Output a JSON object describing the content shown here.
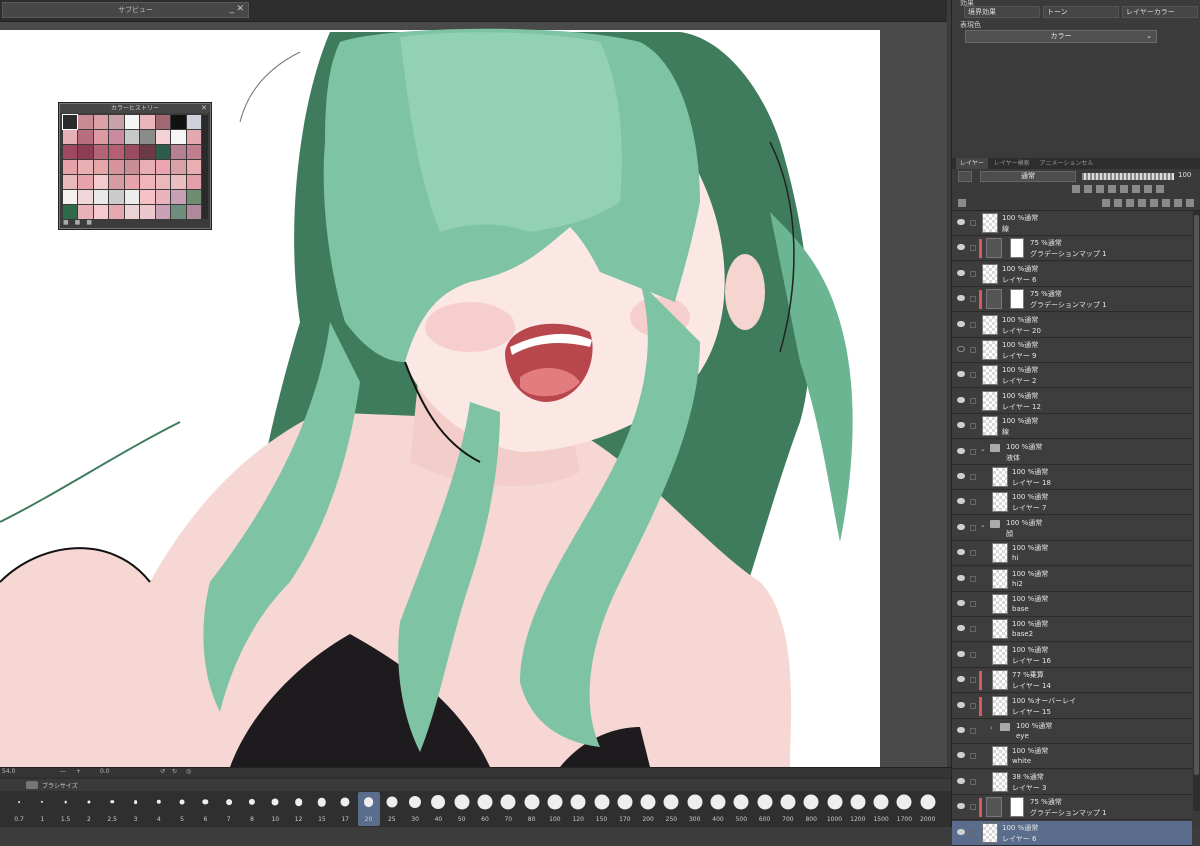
{
  "subwin": {
    "title": "サブビュー",
    "min": "_",
    "close": "✕"
  },
  "history": {
    "title": "カラーヒストリー",
    "close": "✕",
    "colors": [
      "#2b2b2b",
      "#c98a93",
      "#dca0a8",
      "#c7a2ab",
      "#f5f5f5",
      "#e9b6bd",
      "#a06873",
      "#111111",
      "#cfd2da",
      "#e7b0b8",
      "#b76f80",
      "#dd9aa3",
      "#cc8aa0",
      "#c8c8c8",
      "#8b8b8b",
      "#f3d1d4",
      "#f6f6f6",
      "#e3a7b0",
      "#a04a61",
      "#8e3c55",
      "#b46475",
      "#b85e72",
      "#9a4b60",
      "#6c3a44",
      "#2d5d4a",
      "#b68092",
      "#c07f8f",
      "#e6a2a8",
      "#e8b0b3",
      "#e6a5a7",
      "#d7929c",
      "#c98d97",
      "#e7aeb5",
      "#eaa5b0",
      "#d7a3a8",
      "#e8aeb1",
      "#e9b9bc",
      "#e6a4aa",
      "#f1cbcd",
      "#d69ba3",
      "#e8a2ac",
      "#f0b4bb",
      "#eab8bb",
      "#ecbec2",
      "#e39ea9",
      "#f7f0f0",
      "#f0d6d8",
      "#e9e9e9",
      "#cccccc",
      "#ececec",
      "#f6c1c7",
      "#ebb3bb",
      "#c8a0b3",
      "#6d8c70",
      "#2f6b4b",
      "#e9b2ba",
      "#f5c9cf",
      "#e5a8b0",
      "#e9d3d6",
      "#eac8cc",
      "#cba1b7",
      "#6e8d7a",
      "#b0889c"
    ]
  },
  "effect": {
    "label": "効果",
    "options": [
      "境界効果",
      "トーン",
      "レイヤーカラー"
    ],
    "color_label": "表現色",
    "color_value": "カラー"
  },
  "layer_tabs": [
    "レイヤー",
    "レイヤー検索",
    "アニメーションセル"
  ],
  "blend_mode": "通常",
  "opacity": "100",
  "layers": [
    {
      "mode": "100 %通常",
      "name": "線",
      "type": "raster",
      "indent": 0
    },
    {
      "mode": "75 %通常",
      "name": "グラデーションマップ 1",
      "type": "adjust",
      "indent": 0,
      "clip": true
    },
    {
      "mode": "100 %通常",
      "name": "レイヤー 6",
      "type": "raster",
      "indent": 0
    },
    {
      "mode": "75 %通常",
      "name": "グラデーションマップ 1",
      "type": "adjust",
      "indent": 0,
      "clip": true
    },
    {
      "mode": "100 %通常",
      "name": "レイヤー 20",
      "type": "raster",
      "indent": 0
    },
    {
      "mode": "100 %通常",
      "name": "レイヤー 9",
      "type": "raster",
      "indent": 0,
      "hidden": true
    },
    {
      "mode": "100 %通常",
      "name": "レイヤー 2",
      "type": "raster",
      "indent": 0
    },
    {
      "mode": "100 %通常",
      "name": "レイヤー 12",
      "type": "raster",
      "indent": 0
    },
    {
      "mode": "100 %通常",
      "name": "線",
      "type": "raster",
      "indent": 0
    },
    {
      "mode": "100 %通常",
      "name": "液体",
      "type": "folder",
      "indent": 0
    },
    {
      "mode": "100 %通常",
      "name": "レイヤー 18",
      "type": "raster",
      "indent": 1
    },
    {
      "mode": "100 %通常",
      "name": "レイヤー 7",
      "type": "raster",
      "indent": 1
    },
    {
      "mode": "100 %通常",
      "name": "顔",
      "type": "folder",
      "indent": 0
    },
    {
      "mode": "100 %通常",
      "name": "hi",
      "type": "raster",
      "indent": 1
    },
    {
      "mode": "100 %通常",
      "name": "hi2",
      "type": "raster",
      "indent": 1
    },
    {
      "mode": "100 %通常",
      "name": "base",
      "type": "raster",
      "indent": 1
    },
    {
      "mode": "100 %通常",
      "name": "base2",
      "type": "raster",
      "indent": 1
    },
    {
      "mode": "100 %通常",
      "name": "レイヤー 16",
      "type": "raster",
      "indent": 1
    },
    {
      "mode": "77 %乗算",
      "name": "レイヤー 14",
      "type": "raster",
      "indent": 1,
      "clip": true
    },
    {
      "mode": "100 %オーバーレイ",
      "name": "レイヤー 15",
      "type": "raster",
      "indent": 1,
      "clip": true
    },
    {
      "mode": "100 %通常",
      "name": "eye",
      "type": "folder",
      "indent": 1,
      "collapsed": true
    },
    {
      "mode": "100 %通常",
      "name": "white",
      "type": "raster",
      "indent": 1
    },
    {
      "mode": "38 %通常",
      "name": "レイヤー 3",
      "type": "raster",
      "indent": 1
    },
    {
      "mode": "75 %通常",
      "name": "グラデーションマップ 1",
      "type": "adjust",
      "indent": 0,
      "clip": true
    },
    {
      "mode": "100 %通常",
      "name": "レイヤー 6",
      "type": "raster",
      "indent": 0,
      "selected": true
    }
  ],
  "zoom": "54.0",
  "rotation": "0.0",
  "brush_panel": {
    "title": "ブラシサイズ"
  },
  "brush_sizes": [
    "0.7",
    "1",
    "1.5",
    "2",
    "2.5",
    "3",
    "4",
    "5",
    "6",
    "7",
    "8",
    "10",
    "12",
    "15",
    "17",
    "20",
    "25",
    "30",
    "40",
    "50",
    "60",
    "70",
    "80",
    "100",
    "120",
    "150",
    "170",
    "200",
    "250",
    "300",
    "400",
    "500",
    "600",
    "700",
    "800",
    "1000",
    "1200",
    "1500",
    "1700",
    "2000"
  ],
  "brush_selected": "20"
}
